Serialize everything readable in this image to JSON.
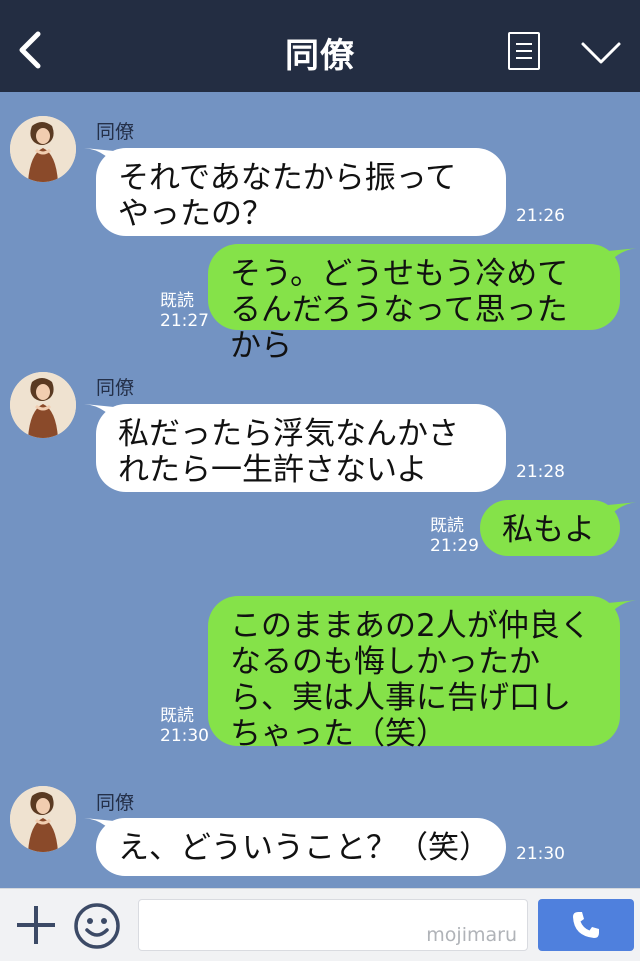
{
  "header": {
    "title": "同僚"
  },
  "messages": [
    {
      "side": "in",
      "sender": "同僚",
      "text": "それであなたから振ってやったの？",
      "time": "21:26"
    },
    {
      "side": "out",
      "read": "既読",
      "text": "そう。どうせもう冷めてるんだろうなって思ったから",
      "time": "21:27"
    },
    {
      "side": "in",
      "sender": "同僚",
      "text": "私だったら浮気なんかされたら一生許さないよ",
      "time": "21:28"
    },
    {
      "side": "out",
      "read": "既読",
      "text": "私もよ",
      "time": "21:29"
    },
    {
      "side": "out",
      "read": "既読",
      "text": "このままあの2人が仲良くなるのも悔しかったから、実は人事に告げ口しちゃった（笑）",
      "time": "21:30"
    },
    {
      "side": "in",
      "sender": "同僚",
      "text": "え、どういうこと？（笑）",
      "time": "21:30"
    }
  ],
  "footer": {
    "watermark": "mojimaru",
    "input_value": ""
  },
  "icons": {
    "back": "chevron-left-icon",
    "menu": "menu-icon",
    "collapse": "chevron-down-icon",
    "plus": "plus-icon",
    "emoji": "smile-icon",
    "call": "phone-icon"
  },
  "colors": {
    "background": "#7393c2",
    "header": "#232d42",
    "outgoing": "#85e249",
    "incoming": "#ffffff",
    "call": "#4f80dd"
  }
}
